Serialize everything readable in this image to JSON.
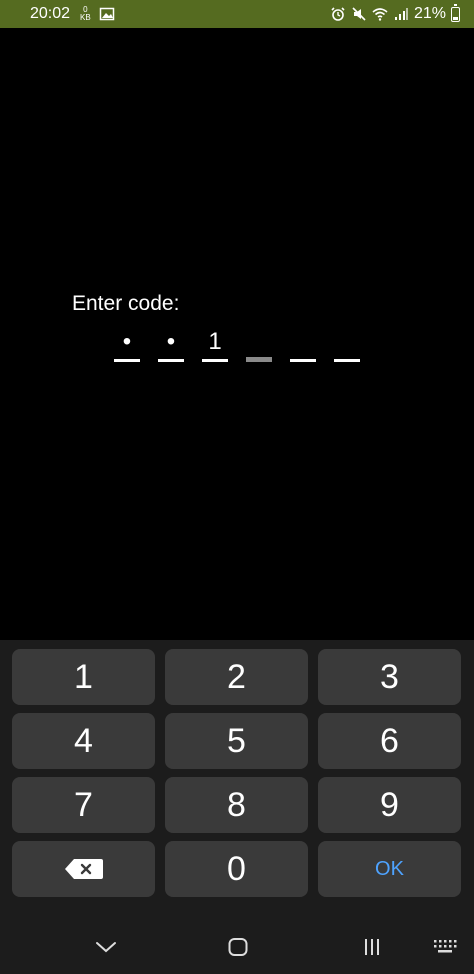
{
  "status": {
    "time": "20:02",
    "data_speed_value": "0",
    "data_speed_unit": "KB",
    "battery": "21%"
  },
  "prompt": "Enter code:",
  "code_slots": [
    "•",
    "•",
    "1",
    "",
    "",
    ""
  ],
  "keypad": {
    "k1": "1",
    "k2": "2",
    "k3": "3",
    "k4": "4",
    "k5": "5",
    "k6": "6",
    "k7": "7",
    "k8": "8",
    "k9": "9",
    "k0": "0",
    "ok": "OK"
  },
  "colors": {
    "statusbar_bg": "#556b20",
    "ok_text": "#4ea3ff",
    "key_bg": "#3a3a3a"
  }
}
